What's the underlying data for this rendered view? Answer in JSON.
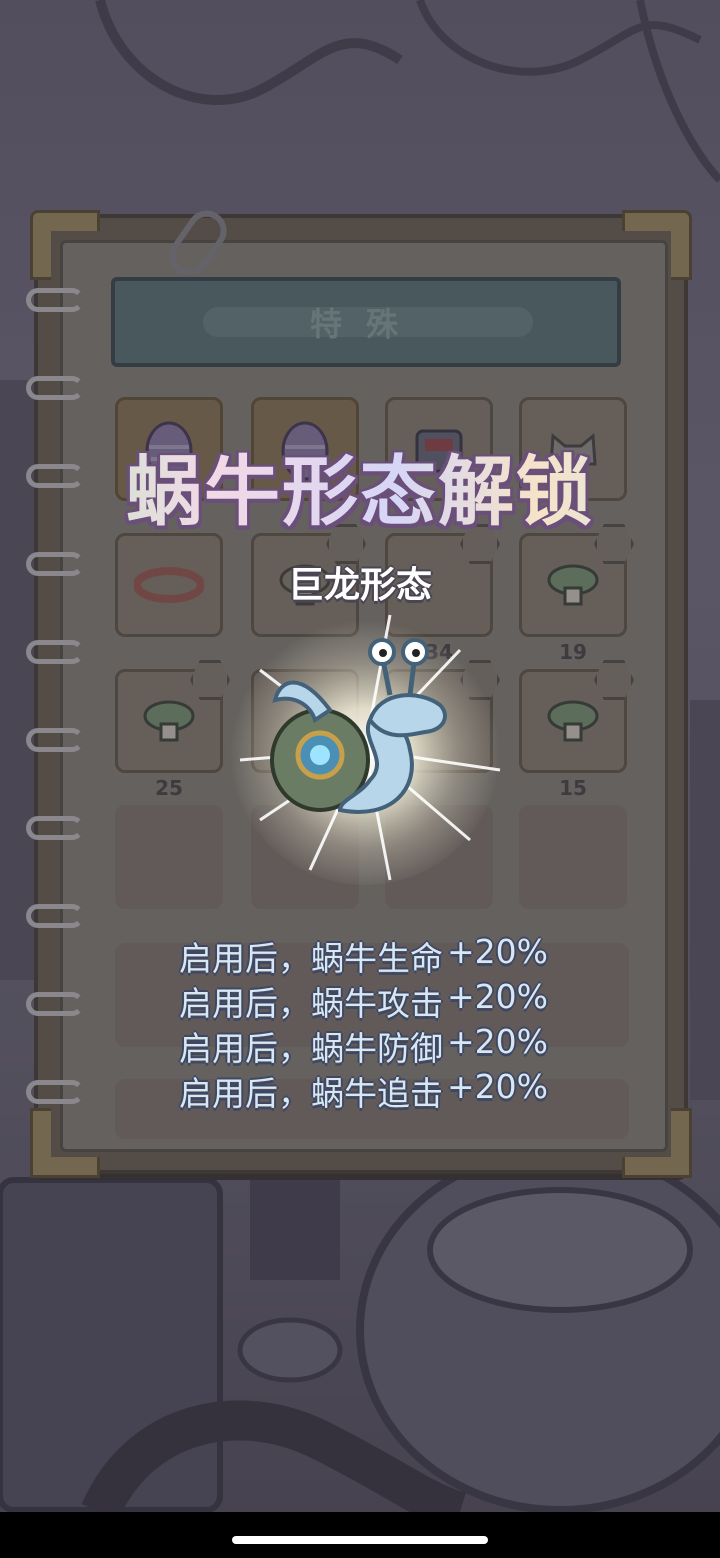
{
  "notebook": {
    "tab_title": "特殊",
    "grid": [
      [
        {
          "icon": "egg-icon",
          "gold": true
        },
        {
          "icon": "egg-icon",
          "gold": true
        },
        {
          "icon": "robot-box-icon"
        },
        {
          "icon": "cat-hat-icon"
        }
      ],
      [
        {
          "icon": "collar-icon"
        },
        {
          "icon": "mushroom-icon",
          "badge": "flower-badge"
        },
        {
          "icon": "mushroom-icon",
          "badge": "leaf-badge",
          "count": "34"
        },
        {
          "icon": "mushroom-icon",
          "badge": "bow-badge",
          "count": "19"
        }
      ],
      [
        {
          "icon": "mushroom-icon",
          "badge": "rose-badge",
          "count": "25"
        },
        {
          "icon": "empty"
        },
        {
          "icon": "mushroom-icon",
          "badge": "bow-badge"
        },
        {
          "icon": "mushroom-icon",
          "badge": "flower-badge",
          "count": "15"
        }
      ]
    ]
  },
  "popup": {
    "title": "蜗牛形态解锁",
    "form_name": "巨龙形态",
    "creature_icon": "dragon-snail-icon",
    "bonuses": [
      {
        "text": "启用后，蜗牛生命",
        "value": "+20%"
      },
      {
        "text": "启用后，蜗牛攻击",
        "value": "+20%"
      },
      {
        "text": "启用后，蜗牛防御",
        "value": "+20%"
      },
      {
        "text": "启用后，蜗牛追击",
        "value": "+20%"
      }
    ]
  },
  "colors": {
    "title_outline": "#6a4f7a",
    "stat_text": "#d8e8f3",
    "page_bg": "#8b8778"
  }
}
